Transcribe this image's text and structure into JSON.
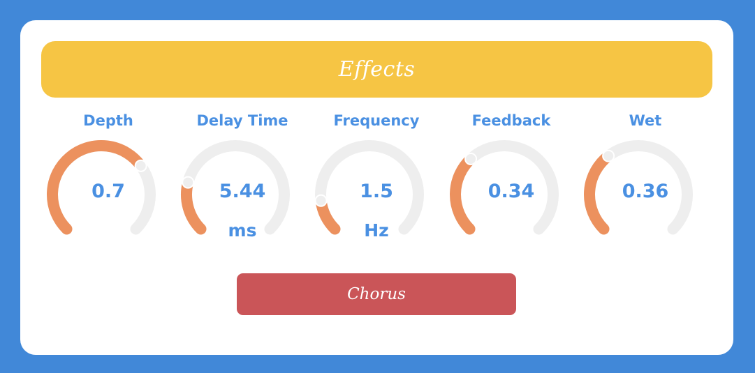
{
  "header": {
    "title": "Effects"
  },
  "colors": {
    "background": "#4188d8",
    "header": "#f6c544",
    "label": "#4a90e2",
    "track": "#eeeeee",
    "fill": "#ec915e",
    "button": "#ca5558"
  },
  "knobs": [
    {
      "label": "Depth",
      "value": "0.7",
      "unit": "",
      "level": 0.7
    },
    {
      "label": "Delay Time",
      "value": "5.44",
      "unit": "ms",
      "level": 0.22
    },
    {
      "label": "Frequency",
      "value": "1.5",
      "unit": "Hz",
      "level": 0.14
    },
    {
      "label": "Feedback",
      "value": "0.34",
      "unit": "",
      "level": 0.34
    },
    {
      "label": "Wet",
      "value": "0.36",
      "unit": "",
      "level": 0.36
    }
  ],
  "button": {
    "label": "Chorus"
  }
}
